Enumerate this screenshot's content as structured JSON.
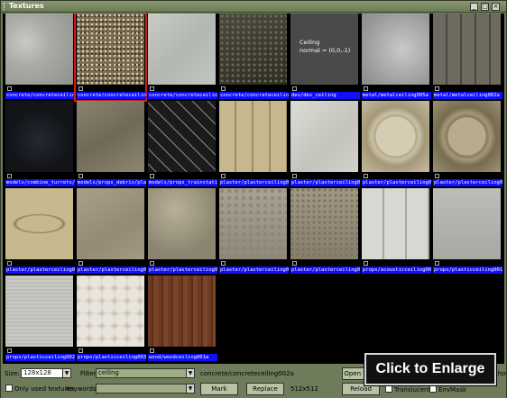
{
  "window": {
    "title": "Textures"
  },
  "tiles": [
    {
      "label": "concrete/concreteceiling001a",
      "texture": "tex-concrete-light",
      "selected": false
    },
    {
      "label": "concrete/concreteceiling002a",
      "texture": "tex-concrete-speckled",
      "selected": true
    },
    {
      "label": "concrete/concreteceiling003a",
      "texture": "tex-concrete-pale",
      "selected": false
    },
    {
      "label": "concrete/concreteceiling004a",
      "texture": "tex-concrete-dark",
      "selected": false
    },
    {
      "label": "dev/dev_ceiling",
      "texture": "tex-dev",
      "selected": false,
      "caption": "Ceiling\nnormal = (0,0,-1)"
    },
    {
      "label": "metal/metalceiling005a",
      "texture": "tex-metal-light",
      "selected": false
    },
    {
      "label": "metal/metalceiling002a",
      "texture": "tex-metal-panel",
      "selected": false
    },
    {
      "label": "models/combine_turrets/ceiling",
      "texture": "tex-turret",
      "selected": false
    },
    {
      "label": "models/props_debris/plasterceiling",
      "texture": "tex-debris",
      "selected": false
    },
    {
      "label": "models/props_trainstation/ceiling",
      "texture": "tex-truss",
      "selected": false
    },
    {
      "label": "plaster/plasterceiling001a",
      "texture": "tex-coffer",
      "selected": false
    },
    {
      "label": "plaster/plasterceiling002a",
      "texture": "tex-plaster-white",
      "selected": false
    },
    {
      "label": "plaster/plasterceiling003a",
      "texture": "tex-ornate-light",
      "selected": false
    },
    {
      "label": "plaster/plasterceiling003b",
      "texture": "tex-ornate-dark",
      "selected": false
    },
    {
      "label": "plaster/plasterceiling005a",
      "texture": "tex-oval",
      "selected": false
    },
    {
      "label": "plaster/plasterceiling006a",
      "texture": "tex-plaster-tan",
      "selected": false
    },
    {
      "label": "plaster/plasterceiling007a",
      "texture": "tex-plaster-stain",
      "selected": false
    },
    {
      "label": "plaster/plasterceiling008a",
      "texture": "tex-plaster-mottled",
      "selected": false
    },
    {
      "label": "plaster/plasterceiling009a",
      "texture": "tex-plaster-rough",
      "selected": false
    },
    {
      "label": "props/acousticceiling001a",
      "texture": "tex-acoustic",
      "selected": false
    },
    {
      "label": "props/plasticceiling001a",
      "texture": "tex-plastic-grey",
      "selected": false
    },
    {
      "label": "props/plasticceiling002a",
      "texture": "tex-plastic-light",
      "selected": false
    },
    {
      "label": "props/plasticceiling003a",
      "texture": "tex-quilted",
      "selected": false
    },
    {
      "label": "wood/woodceiling001a",
      "texture": "tex-wood",
      "selected": false
    }
  ],
  "controls": {
    "size_label": "Size:",
    "size_value": "128x128",
    "filter_label": "Filter:",
    "filter_value": "ceiling",
    "selected_path": "concrete/concreteceiling002a",
    "open_source_label": "Open S",
    "only_used_label": "Only used textures",
    "keywords_label": "Keywords:",
    "keywords_value": "",
    "mark_label": "Mark",
    "replace_label": "Replace",
    "dimensions": "512x512",
    "reload_label": "Reload",
    "show_label": "Show",
    "translucent_label": "Translucent",
    "envmask_label": "EnvMask"
  },
  "overlay": {
    "enlarge_text": "Click to Enlarge"
  },
  "icons": {
    "minimize": "minimize-icon",
    "maximize": "maximize-icon",
    "close": "close-icon",
    "dropdown": "chevron-down-icon"
  }
}
